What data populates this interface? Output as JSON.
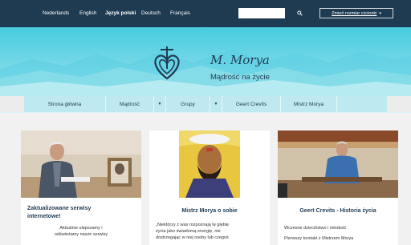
{
  "languages": [
    {
      "label": "Nederlands",
      "active": false
    },
    {
      "label": "English",
      "active": false
    },
    {
      "label": "Język polski",
      "active": true
    },
    {
      "label": "Deutsch",
      "active": false
    },
    {
      "label": "Français",
      "active": false
    }
  ],
  "search": {
    "value": "",
    "placeholder": ""
  },
  "font_size_button": {
    "label": "Zmień rozmiar czcionki",
    "icon": "chevron-down-icon"
  },
  "logo": {
    "signature": "M. Morya",
    "tagline": "Mądrość na życie"
  },
  "menu": {
    "items": [
      "Strona główna",
      "Mądrość",
      "Grupy",
      "Geert Crevits",
      "Mistrz Morya"
    ]
  },
  "cards": [
    {
      "title_line1": "Zaktualizowane serwisy",
      "title_line2": "internetowe!",
      "text_line1": "Aktualnie ulepszamy i",
      "text_line2": "odświeżamy nasze serwisy"
    },
    {
      "title": "Mistrz Morya o sobie",
      "text_line1": "„Niektórzy z was rozpoznają tę głębię",
      "text_line2": "życia jako świadomą energię, nie",
      "text_line3": "dostrzegając w niej osoby lub czegoś"
    },
    {
      "title": "Geert Crevits - Historia życia",
      "text_line1": "Wczesne dzieciństwo i młodość",
      "text_line2": "Pierwszy kontakt z Mistrzem Morya"
    }
  ],
  "colors": {
    "nav_bg": "#1f3b52",
    "hero_top": "#47cbe0",
    "menu_bg": "#bfe9f0",
    "text_dark": "#1f3b52"
  }
}
